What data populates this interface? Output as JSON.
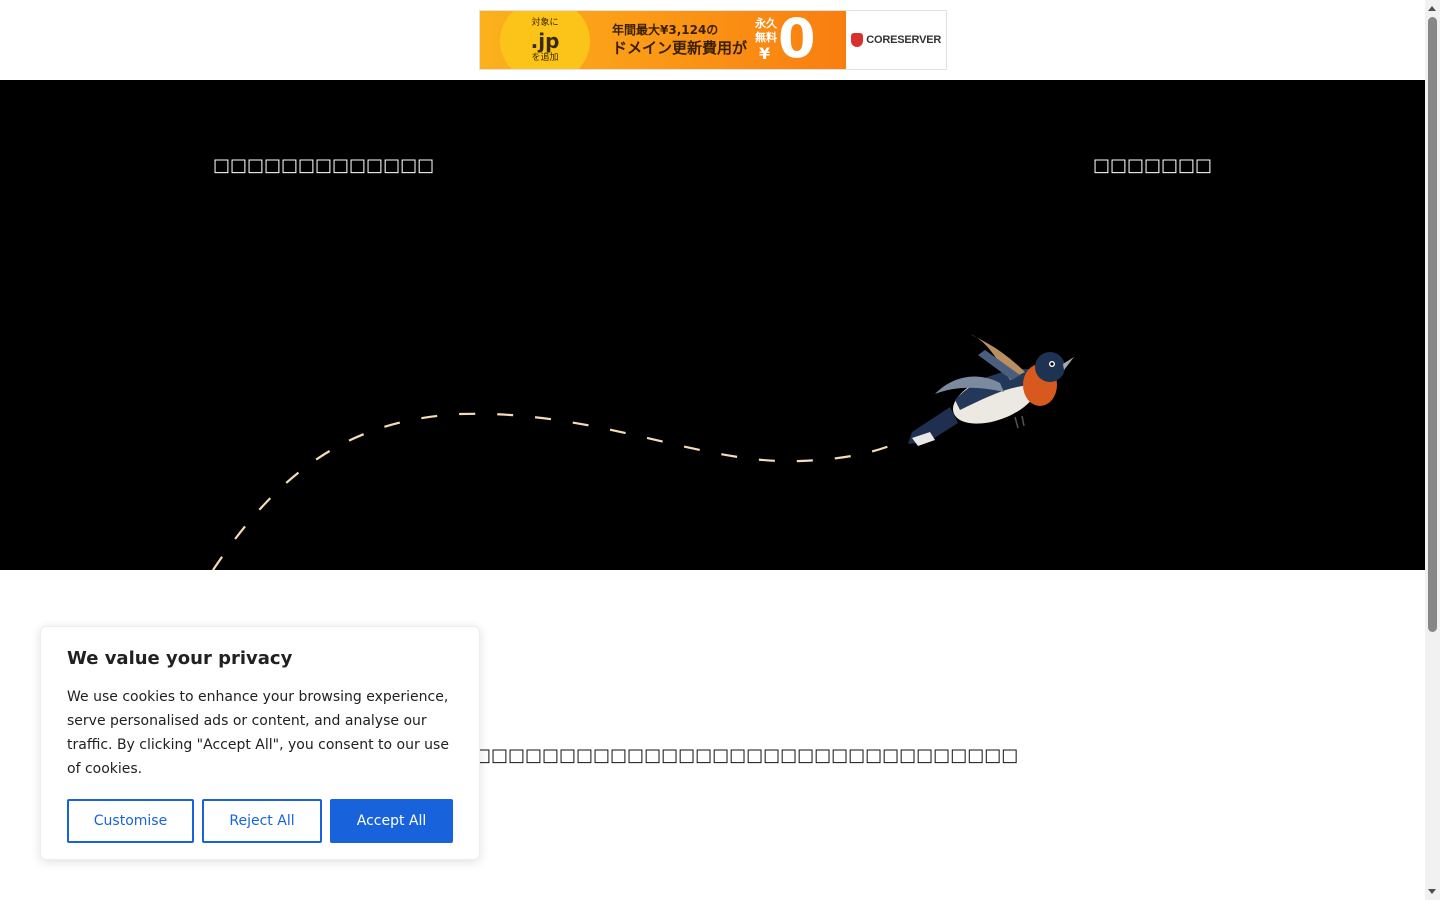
{
  "ad": {
    "circle_top": "対象に",
    "circle_tld": ".jp",
    "circle_bottom": "を追加",
    "copy_line1": "年間最大¥3,124の",
    "copy_line2": "ドメイン更新費用が",
    "free_label": "永久無料",
    "yen": "¥",
    "price": "0",
    "brand": "CORESERVER"
  },
  "header": {
    "site_title": "□□□□□□□□□□□□□",
    "menu": "□□□□□□□"
  },
  "content": {
    "paragraph": "□□□□□□□□□□□□□□□□□□□□□□□□□□□□□□□□"
  },
  "cookie_banner": {
    "title": "We value your privacy",
    "text": "We use cookies to enhance your browsing experience, serve personalised ads or content, and analyse our traffic. By clicking \"Accept All\", you consent to our use of cookies.",
    "customise_label": "Customise",
    "reject_label": "Reject All",
    "accept_label": "Accept All"
  },
  "colors": {
    "hero_bg": "#000000",
    "flight_path": "#f4dcb8",
    "accent_blue": "#1863dc"
  }
}
